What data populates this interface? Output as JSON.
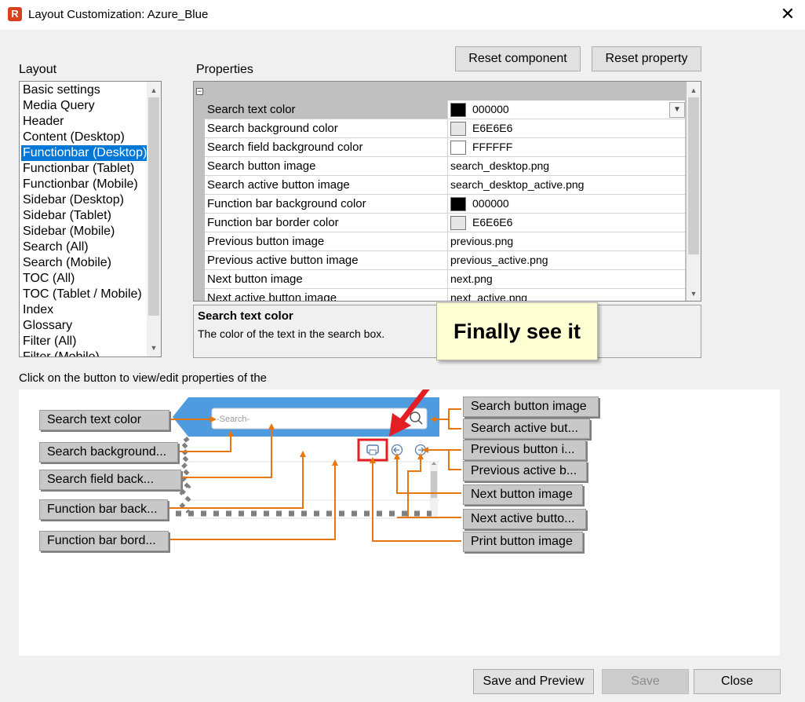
{
  "window": {
    "title": "Layout Customization: Azure_Blue",
    "close_glyph": "✕",
    "app_icon_glyph": "R"
  },
  "toolbar": {
    "reset_component": "Reset component",
    "reset_property": "Reset property"
  },
  "layout": {
    "label": "Layout",
    "selected_index": 4,
    "items": [
      "Basic settings",
      "Media Query",
      "Header",
      "Content (Desktop)",
      "Functionbar (Desktop)",
      "Functionbar (Tablet)",
      "Functionbar (Mobile)",
      "Sidebar (Desktop)",
      "Sidebar (Tablet)",
      "Sidebar (Mobile)",
      "Search (All)",
      "Search (Mobile)",
      "TOC (All)",
      "TOC (Tablet / Mobile)",
      "Index",
      "Glossary",
      "Filter (All)",
      "Filter (Mobile)"
    ]
  },
  "properties": {
    "label": "Properties",
    "collapse_glyph": "−",
    "rows": [
      {
        "name": "Search text color",
        "value": "000000",
        "swatch": "#000000"
      },
      {
        "name": "Search background color",
        "value": "E6E6E6",
        "swatch": "#E6E6E6"
      },
      {
        "name": "Search field background color",
        "value": "FFFFFF",
        "swatch": "#FFFFFF"
      },
      {
        "name": "Search button image",
        "value": "search_desktop.png"
      },
      {
        "name": "Search active button image",
        "value": "search_desktop_active.png"
      },
      {
        "name": "Function bar background color",
        "value": "000000",
        "swatch": "#000000"
      },
      {
        "name": "Function bar border color",
        "value": "E6E6E6",
        "swatch": "#E6E6E6"
      },
      {
        "name": "Previous button image",
        "value": "previous.png"
      },
      {
        "name": "Previous active button image",
        "value": "previous_active.png"
      },
      {
        "name": "Next button image",
        "value": "next.png"
      },
      {
        "name": "Next active button image",
        "value": "next_active.png"
      }
    ]
  },
  "description": {
    "title": "Search text color",
    "text": "The color of the text in the search box."
  },
  "callout": {
    "text": "Finally see it",
    "color": "#e31e24"
  },
  "preview": {
    "instruction": "Click on the button to view/edit properties of the",
    "search_placeholder": "-Search-",
    "accent_color": "#4f9be0",
    "connector_color": "#e8760f",
    "left_buttons": [
      "Search text color",
      "Search background...",
      "Search field back...",
      "Function bar back...",
      "Function bar bord..."
    ],
    "right_buttons": [
      "Search button image",
      "Search active but...",
      "Previous button i...",
      "Previous active b...",
      "Next button image",
      "Next active butto...",
      "Print button image"
    ]
  },
  "footer": {
    "save_preview": "Save and Preview",
    "save": "Save",
    "close": "Close"
  }
}
